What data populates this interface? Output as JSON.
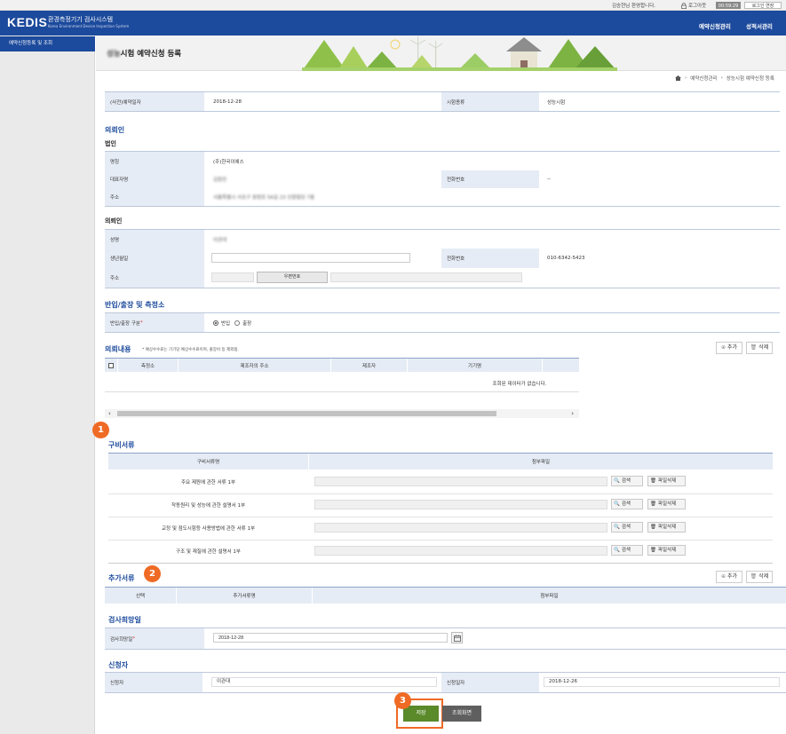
{
  "topbar": {
    "welcome": "김승현님 환영합니다.",
    "logout": "로그아웃",
    "timer": "00:59:29",
    "extend": "로그인 연장"
  },
  "header": {
    "logo": "KEDIS",
    "logo_ko": "환경측정기기 검사시스템",
    "logo_en": "Korea Environment Device Inspection System",
    "nav": [
      "예약신청관리",
      "성적서관리"
    ]
  },
  "sidebar": {
    "items": [
      {
        "label": "예약신청등록 및 조회"
      }
    ]
  },
  "page": {
    "title_prefix": "성능",
    "title": "시험 예약신청 등록",
    "breadcrumb": [
      "예약신청관리",
      "성능시험 예약신청 등록"
    ]
  },
  "reservation": {
    "date_label": "(사전)예약일자",
    "date_value": "2018-12-28",
    "type_label": "시험종류",
    "type_value": "성능시험"
  },
  "client": {
    "section_title": "의뢰인",
    "corp_title": "법인",
    "corp_name_label": "명칭",
    "corp_name_value": "(주)한국이에스",
    "rep_label": "대표자명",
    "rep_value": "김원진",
    "phone_label": "전화번호",
    "phone_value": "--",
    "addr_label": "주소",
    "addr_value": "서울특별시 서초구 효령로 56길 23 신원빌딩 7층",
    "person_title": "의뢰인",
    "person_name_label": "성명",
    "person_name_value": "이관대",
    "birth_label": "생년월일",
    "birth_value": "",
    "person_phone_label": "전화번호",
    "person_phone_value": "010-6342-5423",
    "person_addr_label": "주소",
    "zip_button": "우편번호"
  },
  "carry": {
    "section_title": "반입/출장 및 측정소",
    "label": "반입/출장 구분",
    "required_mark": "*",
    "opt_in": "반입",
    "opt_out": "출장"
  },
  "request": {
    "section_title": "의뢰내용",
    "note": "* 예상수수료는 기기당 예상수수료이며, 출장비 등 제외됨.",
    "add_button": "추가",
    "delete_button": "삭제",
    "columns": [
      "측정소",
      "제조자의 주소",
      "제조자",
      "기기명"
    ],
    "empty_text": "조회된 데이터가 없습니다."
  },
  "docs": {
    "section_title": "구비서류",
    "col_name": "구비서류명",
    "col_file": "첨부파일",
    "search_button": "검색",
    "delete_file_button": "파일삭제",
    "rows": [
      {
        "name": "주요 제원에 관한 서류 1부"
      },
      {
        "name": "작동원리 및 성능에 관한 설명서 1부"
      },
      {
        "name": "교정 및 점도시험등 사용방법에 관한 서류 1부"
      },
      {
        "name": "구조 및 재질에 관한 설명서 1부"
      }
    ]
  },
  "extra": {
    "section_title": "추가서류",
    "add_button": "추가",
    "delete_button": "삭제",
    "col_select": "선택",
    "col_name": "추가서류명",
    "col_file": "첨부파일"
  },
  "inspection": {
    "section_title": "검사희망일",
    "label": "검사희망일",
    "required_mark": "*",
    "value": "2018-12-28"
  },
  "applicant": {
    "section_title": "신청자",
    "name_label": "신청자",
    "name_value": "이관대",
    "date_label": "신청일자",
    "date_value": "2018-12-26"
  },
  "actions": {
    "save": "저장",
    "list": "조회화면"
  },
  "markers": [
    "1",
    "2",
    "3"
  ],
  "colors": {
    "brand": "#1c4a9c",
    "marker": "#ef6a24",
    "save": "#5a8a2a",
    "list": "#5f5f5f"
  }
}
